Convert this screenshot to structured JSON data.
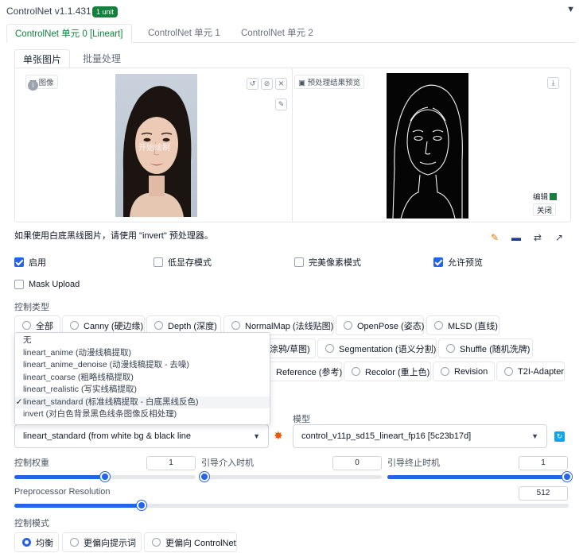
{
  "header": {
    "title": "ControlNet v1.1.431",
    "badge": "1 unit"
  },
  "units_tabs": [
    {
      "label": "ControlNet 单元 0 [Lineart]",
      "active": true
    },
    {
      "label": "ControlNet 单元 1",
      "active": false
    },
    {
      "label": "ControlNet 单元 2",
      "active": false
    }
  ],
  "image_tabs": [
    {
      "label": "单张图片",
      "active": true
    },
    {
      "label": "批量处理",
      "active": false
    }
  ],
  "input_panel": {
    "label": "图像",
    "watermark": "开始绘制"
  },
  "preview_panel": {
    "label": "预处理结果预览",
    "edit": "编辑",
    "close": "关闭"
  },
  "hint": "如果使用白底黑线图片，请使用 \"invert\" 预处理器。",
  "checkboxes": {
    "enable": {
      "label": "启用",
      "checked": true
    },
    "low_vram": {
      "label": "低显存模式",
      "checked": false
    },
    "pixel_perfect": {
      "label": "完美像素模式",
      "checked": false
    },
    "allow_preview": {
      "label": "允许预览",
      "checked": true
    },
    "mask_upload": {
      "label": "Mask Upload",
      "checked": false
    }
  },
  "control_type": {
    "label": "控制类型",
    "row1": [
      "全部",
      "Canny (硬边缘)",
      "Depth (深度)",
      "NormalMap (法线贴图)",
      "OpenPose (姿态)",
      "MLSD (直线)"
    ],
    "row2": [
      "涂鸦/草图)",
      "Segmentation (语义分割)",
      "Shuffle (随机洗牌)"
    ],
    "row3": [
      "Reference (参考)",
      "Recolor (重上色)",
      "Revision",
      "T2I-Adapter"
    ]
  },
  "preprocessor_options": [
    {
      "label": "无",
      "selected": false
    },
    {
      "label": "lineart_anime (动漫线稿提取)",
      "selected": false
    },
    {
      "label": "lineart_anime_denoise (动漫线稿提取 - 去噪)",
      "selected": false
    },
    {
      "label": "lineart_coarse (粗略线稿提取)",
      "selected": false
    },
    {
      "label": "lineart_realistic (写实线稿提取)",
      "selected": false
    },
    {
      "label": "lineart_standard (标准线稿提取 - 白底黑线反色)",
      "selected": true
    },
    {
      "label": "invert (对白色背景黑色线条图像反相处理)",
      "selected": false
    }
  ],
  "check_mark": "✓",
  "preprocessor": {
    "value": "lineart_standard (from white bg & black line"
  },
  "model": {
    "label": "模型",
    "value": "control_v11p_sd15_lineart_fp16 [5c23b17d]"
  },
  "sliders": {
    "weight": {
      "label": "控制权重",
      "value": "1",
      "fraction": 0.5
    },
    "start": {
      "label": "引导介入时机",
      "value": "0",
      "fraction": 0.0
    },
    "end": {
      "label": "引导终止时机",
      "value": "1",
      "fraction": 1.0
    },
    "resolution": {
      "label": "Preprocessor Resolution",
      "value": "512",
      "fraction": 0.23
    }
  },
  "control_mode": {
    "label": "控制模式",
    "options": [
      {
        "label": "均衡",
        "selected": true
      },
      {
        "label": "更偏向提示词",
        "selected": false
      },
      {
        "label": "更偏向 ControlNet",
        "selected": false
      }
    ]
  },
  "colors": {
    "accent": "#2563eb",
    "badge": "#15803d",
    "tab_active": "#15803d"
  }
}
